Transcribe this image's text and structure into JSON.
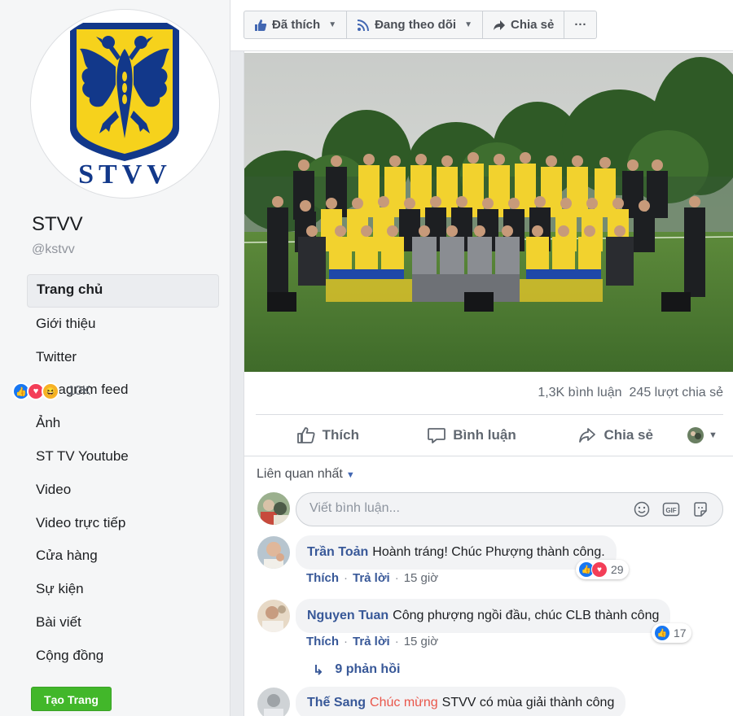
{
  "page": {
    "name": "STVV",
    "handle": "@kstvv",
    "logo_text": "STVV",
    "brand_colors": {
      "crest_blue": "#12388a",
      "crest_yellow": "#f6d21c"
    }
  },
  "nav": {
    "items": [
      {
        "label": "Trang chủ",
        "active": true
      },
      {
        "label": "Giới thiệu"
      },
      {
        "label": "Twitter"
      },
      {
        "label": "Instagram feed"
      },
      {
        "label": "Ảnh"
      },
      {
        "label": "ST TV Youtube"
      },
      {
        "label": "Video"
      },
      {
        "label": "Video trực tiếp"
      },
      {
        "label": "Cửa hàng"
      },
      {
        "label": "Sự kiện"
      },
      {
        "label": "Bài viết"
      },
      {
        "label": "Cộng đồng"
      }
    ],
    "create_page_label": "Tạo Trang"
  },
  "actions": {
    "liked": "Đã thích",
    "following": "Đang theo dõi",
    "share": "Chia sẻ",
    "more": "···"
  },
  "post": {
    "reaction_count": "10K",
    "comment_count": "1,3K bình luận",
    "share_count": "245 lượt chia sẻ",
    "like_action": "Thích",
    "comment_action": "Bình luận",
    "share_action": "Chia sẻ"
  },
  "comments": {
    "sort_label": "Liên quan nhất",
    "input_placeholder": "Viết bình luận...",
    "items": [
      {
        "author": "Trần Toản",
        "text": "Hoành tráng! Chúc Phượng thành công.",
        "like": "Thích",
        "reply": "Trả lời",
        "time": "15 giờ",
        "reactions": "29"
      },
      {
        "author": "Nguyen Tuan",
        "text": "Công phượng ngồi đầu, chúc CLB thành công",
        "like": "Thích",
        "reply": "Trả lời",
        "time": "15 giờ",
        "reactions": "17",
        "replies_label": "9 phản hồi"
      },
      {
        "author": "Thế Sang",
        "tag": "Chúc mừng",
        "text": "STVV có mùa giải thành công"
      }
    ]
  }
}
